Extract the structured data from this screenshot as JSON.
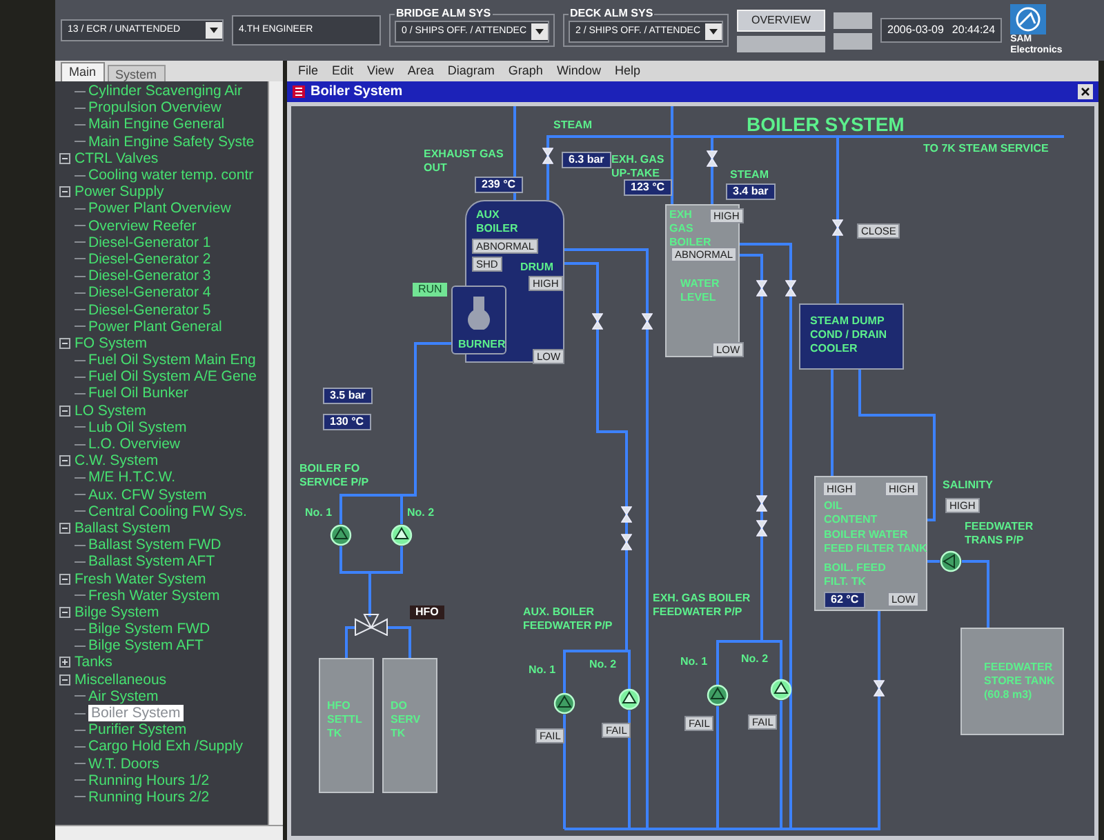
{
  "top_bar": {
    "location": "13 / ECR / UNATTENDED",
    "duty": "4.TH ENGINEER",
    "bridge_alarm": {
      "label": "BRIDGE ALM SYS",
      "value": "0 / SHIPS OFF. / ATTENDEC"
    },
    "deck_alarm": {
      "label": "DECK ALM SYS",
      "value": "2 / SHIPS OFF. / ATTENDEC"
    },
    "overview_button": "OVERVIEW",
    "date": "2006-03-09",
    "time": "20:44:24",
    "logo": {
      "name": "SAM",
      "subtitle": "Electronics"
    }
  },
  "sidebar": {
    "tabs": [
      {
        "label": "Main",
        "selected": true
      },
      {
        "label": "System",
        "selected": false
      }
    ],
    "tree": [
      {
        "children": [
          {
            "label": "Cylinder Scavenging Air",
            "selected": false
          },
          {
            "label": "Propulsion Overview",
            "selected": false
          },
          {
            "label": "Main Engine General",
            "selected": false
          },
          {
            "label": "Main Engine Safety Syste",
            "selected": false
          }
        ]
      },
      {
        "label": "CTRL Valves",
        "expanded": true,
        "children": [
          {
            "label": "Cooling water temp. contr",
            "selected": false
          }
        ]
      },
      {
        "label": "Power Supply",
        "expanded": true,
        "children": [
          {
            "label": "Power Plant Overview",
            "selected": false
          },
          {
            "label": "Overview Reefer",
            "selected": false
          },
          {
            "label": "Diesel-Generator 1",
            "selected": false
          },
          {
            "label": "Diesel-Generator 2",
            "selected": false
          },
          {
            "label": "Diesel-Generator 3",
            "selected": false
          },
          {
            "label": "Diesel-Generator 4",
            "selected": false
          },
          {
            "label": "Diesel-Generator 5",
            "selected": false
          },
          {
            "label": "Power Plant General",
            "selected": false
          }
        ]
      },
      {
        "label": "FO System",
        "expanded": true,
        "children": [
          {
            "label": "Fuel Oil System Main Eng",
            "selected": false
          },
          {
            "label": "Fuel Oil System A/E Gene",
            "selected": false
          },
          {
            "label": "Fuel Oil Bunker",
            "selected": false
          }
        ]
      },
      {
        "label": "LO System",
        "expanded": true,
        "children": [
          {
            "label": "Lub Oil System",
            "selected": false
          },
          {
            "label": "L.O. Overview",
            "selected": false
          }
        ]
      },
      {
        "label": "C.W. System",
        "expanded": true,
        "children": [
          {
            "label": "M/E H.T.C.W.",
            "selected": false
          },
          {
            "label": "Aux. CFW System",
            "selected": false
          },
          {
            "label": "Central Cooling FW Sys.",
            "selected": false
          }
        ]
      },
      {
        "label": "Ballast System",
        "expanded": true,
        "children": [
          {
            "label": "Ballast System FWD",
            "selected": false
          },
          {
            "label": "Ballast System AFT",
            "selected": false
          }
        ]
      },
      {
        "label": "Fresh Water System",
        "expanded": true,
        "children": [
          {
            "label": "Fresh Water System",
            "selected": false
          }
        ]
      },
      {
        "label": "Bilge System",
        "expanded": true,
        "children": [
          {
            "label": "Bilge System FWD",
            "selected": false
          },
          {
            "label": "Bilge System AFT",
            "selected": false
          }
        ]
      },
      {
        "label": "Tanks",
        "expanded": false
      },
      {
        "label": "Miscellaneous",
        "expanded": true,
        "children": [
          {
            "label": "Air System",
            "selected": false
          },
          {
            "label": "Boiler System",
            "selected": true
          },
          {
            "label": "Purifier System",
            "selected": false
          },
          {
            "label": "Cargo Hold Exh /Supply",
            "selected": false
          },
          {
            "label": "W.T. Doors",
            "selected": false
          },
          {
            "label": "Running Hours 1/2",
            "selected": false
          },
          {
            "label": "Running Hours 2/2",
            "selected": false
          }
        ]
      }
    ]
  },
  "menu": [
    "File",
    "Edit",
    "View",
    "Area",
    "Diagram",
    "Graph",
    "Window",
    "Help"
  ],
  "window": {
    "title": "Boiler System"
  },
  "diagram": {
    "title": "BOILER SYSTEM",
    "texts": [
      {
        "kind": "label",
        "lines": [
          "TO 7K STEAM SERVICE"
        ]
      },
      {
        "kind": "label",
        "lines": [
          "STEAM"
        ]
      },
      {
        "kind": "reading",
        "text": "6.3 bar"
      },
      {
        "kind": "label",
        "lines": [
          "EXHAUST GAS",
          "OUT"
        ]
      },
      {
        "kind": "reading",
        "text": "239 °C"
      },
      {
        "kind": "label",
        "lines": [
          "EXH. GAS",
          "UP-TAKE"
        ]
      },
      {
        "kind": "reading",
        "text": "123 °C"
      },
      {
        "kind": "label",
        "lines": [
          "STEAM"
        ]
      },
      {
        "kind": "reading",
        "text": "3.4 bar"
      },
      {
        "kind": "label",
        "lines": [
          "AUX",
          "BOILER"
        ]
      },
      {
        "kind": "label",
        "lines": [
          "EXH",
          "GAS",
          "BOILER"
        ]
      },
      {
        "kind": "alarm",
        "text": "HIGH"
      },
      {
        "kind": "alarm",
        "text": "ABNORMAL"
      },
      {
        "kind": "alarm",
        "text": "ABNORMAL"
      },
      {
        "kind": "alarm",
        "text": "CLOSE"
      },
      {
        "kind": "alarm",
        "text": "SHD"
      },
      {
        "kind": "label",
        "lines": [
          "DRUM"
        ]
      },
      {
        "kind": "alarm",
        "text": "HIGH"
      },
      {
        "kind": "label",
        "lines": [
          "WATER",
          "LEVEL"
        ]
      },
      {
        "kind": "run",
        "text": "RUN"
      },
      {
        "kind": "label",
        "lines": [
          "BURNER"
        ]
      },
      {
        "kind": "alarm",
        "text": "LOW"
      },
      {
        "kind": "alarm",
        "text": "LOW"
      },
      {
        "kind": "label",
        "lines": [
          "STEAM DUMP",
          "COND / DRAIN",
          "COOLER"
        ]
      },
      {
        "kind": "reading",
        "text": "3.5 bar"
      },
      {
        "kind": "reading",
        "text": "130 °C"
      },
      {
        "kind": "label",
        "lines": [
          "BOILER FO",
          "SERVICE P/P"
        ]
      },
      {
        "kind": "alarm",
        "text": "HIGH"
      },
      {
        "kind": "alarm",
        "text": "HIGH"
      },
      {
        "kind": "label",
        "lines": [
          "SALINITY"
        ]
      },
      {
        "kind": "alarm",
        "text": "HIGH"
      },
      {
        "kind": "label",
        "lines": [
          "OIL",
          "CONTENT"
        ]
      },
      {
        "kind": "label",
        "lines": [
          "BOILER WATER",
          "FEED FILTER TANK"
        ]
      },
      {
        "kind": "label",
        "lines": [
          "FEEDWATER",
          "TRANS P/P"
        ]
      },
      {
        "kind": "label",
        "lines": [
          "No. 1"
        ]
      },
      {
        "kind": "label",
        "lines": [
          "No. 2"
        ]
      },
      {
        "kind": "label",
        "lines": [
          "BOIL. FEED",
          "FILT. TK"
        ]
      },
      {
        "kind": "reading",
        "text": "62 °C"
      },
      {
        "kind": "alarm",
        "text": "LOW"
      },
      {
        "kind": "tag",
        "text": "HFO"
      },
      {
        "kind": "label",
        "lines": [
          "EXH. GAS BOILER",
          "FEEDWATER P/P"
        ]
      },
      {
        "kind": "label",
        "lines": [
          "AUX. BOILER",
          "FEEDWATER P/P"
        ]
      },
      {
        "kind": "label",
        "lines": [
          "FEEDWATER",
          "STORE TANK",
          "(60.8 m3)"
        ]
      },
      {
        "kind": "label",
        "lines": [
          "No. 1"
        ]
      },
      {
        "kind": "label",
        "lines": [
          "No. 2"
        ]
      },
      {
        "kind": "label",
        "lines": [
          "No. 1"
        ]
      },
      {
        "kind": "label",
        "lines": [
          "No. 2"
        ]
      },
      {
        "kind": "alarm",
        "text": "FAIL"
      },
      {
        "kind": "alarm",
        "text": "FAIL"
      },
      {
        "kind": "alarm",
        "text": "FAIL"
      },
      {
        "kind": "alarm",
        "text": "FAIL"
      },
      {
        "kind": "label",
        "lines": [
          "HFO",
          "SETTL",
          "TK"
        ]
      },
      {
        "kind": "label",
        "lines": [
          "DO",
          "SERV",
          "TK"
        ]
      }
    ],
    "pumps": [
      {
        "running": false
      },
      {
        "running": true
      },
      {
        "running": false
      },
      {
        "running": true
      },
      {
        "running": false
      },
      {
        "running": true
      },
      {
        "running": false
      }
    ]
  }
}
